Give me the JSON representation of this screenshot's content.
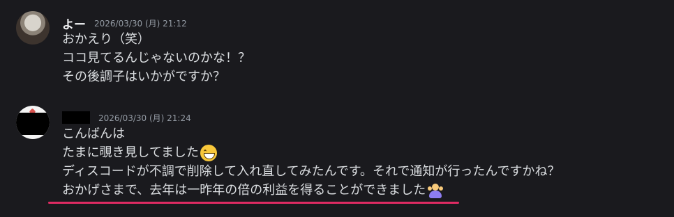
{
  "messages": [
    {
      "username": "よー",
      "timestamp": "2026/03/30 (月) 21:12",
      "lines": [
        "おかえり（笑）",
        "ココ見てるんじゃないのかな！？",
        "その後調子はいかがですか？"
      ]
    },
    {
      "timestamp": "2026/03/30 (月) 21:24",
      "lines": [
        "こんばんは",
        "たまに覗き見してました",
        "ディスコードが不調で削除して入れ直してみたんです。それで通知が行ったんですかね？",
        "おかげさまで、去年は一昨年の倍の利益を得ることができました"
      ]
    }
  ],
  "icons": {
    "grin": "grinning-face-emoji",
    "person": "person-gesturing-emoji"
  },
  "colors": {
    "background": "#1a1a1e",
    "text": "#dbdee1",
    "timestamp": "#949ba4",
    "highlight_underline": "#e02b63"
  }
}
